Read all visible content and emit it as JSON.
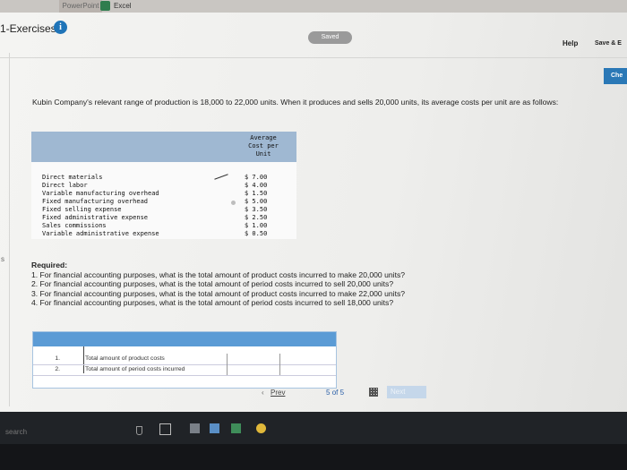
{
  "topbar": {
    "powerpoint": "PowerPoint",
    "excel": "Excel"
  },
  "header": {
    "title": "1-Exercises",
    "saved": "Saved",
    "help": "Help",
    "save_exit": "Save & E",
    "check": "Che"
  },
  "side": {
    "arrow": "s"
  },
  "intro": "Kubin Company's relevant range of production is 18,000 to 22,000 units. When it produces and sells 20,000 units, its average costs per unit are as follows:",
  "cost_table": {
    "header": [
      "Average",
      "Cost per",
      "Unit"
    ],
    "rows": [
      {
        "label": "Direct materials",
        "value": "$ 7.00"
      },
      {
        "label": "Direct labor",
        "value": "$ 4.00"
      },
      {
        "label": "Variable manufacturing overhead",
        "value": "$ 1.50"
      },
      {
        "label": "Fixed manufacturing overhead",
        "value": "$ 5.00"
      },
      {
        "label": "Fixed selling expense",
        "value": "$ 3.50"
      },
      {
        "label": "Fixed administrative expense",
        "value": "$ 2.50"
      },
      {
        "label": "Sales commissions",
        "value": "$ 1.00"
      },
      {
        "label": "Variable administrative expense",
        "value": "$ 0.50"
      }
    ]
  },
  "required": {
    "heading": "Required:",
    "items": [
      "1. For financial accounting purposes, what is the total amount of product costs incurred to make 20,000 units?",
      "2. For financial accounting purposes, what is the total amount of period costs incurred to sell 20,000 units?",
      "3. For financial accounting purposes, what is the total amount of product costs incurred to make 22,000 units?",
      "4. For financial accounting purposes, what is the total amount of period costs incurred to sell 18,000 units?"
    ]
  },
  "answer_table": {
    "rows": [
      {
        "num": "1.",
        "label": "Total amount of product costs",
        "value": ""
      },
      {
        "num": "2.",
        "label": "Total amount of period costs incurred",
        "value": ""
      }
    ]
  },
  "nav": {
    "prev": "Prev",
    "page": "5",
    "of_label": "of",
    "total": "5",
    "next": "Next"
  },
  "taskbar": {
    "search": "search"
  },
  "colors": {
    "accent": "#2a78b6",
    "table_header": "#9fb8d2",
    "answer_header": "#5b9bd5"
  }
}
